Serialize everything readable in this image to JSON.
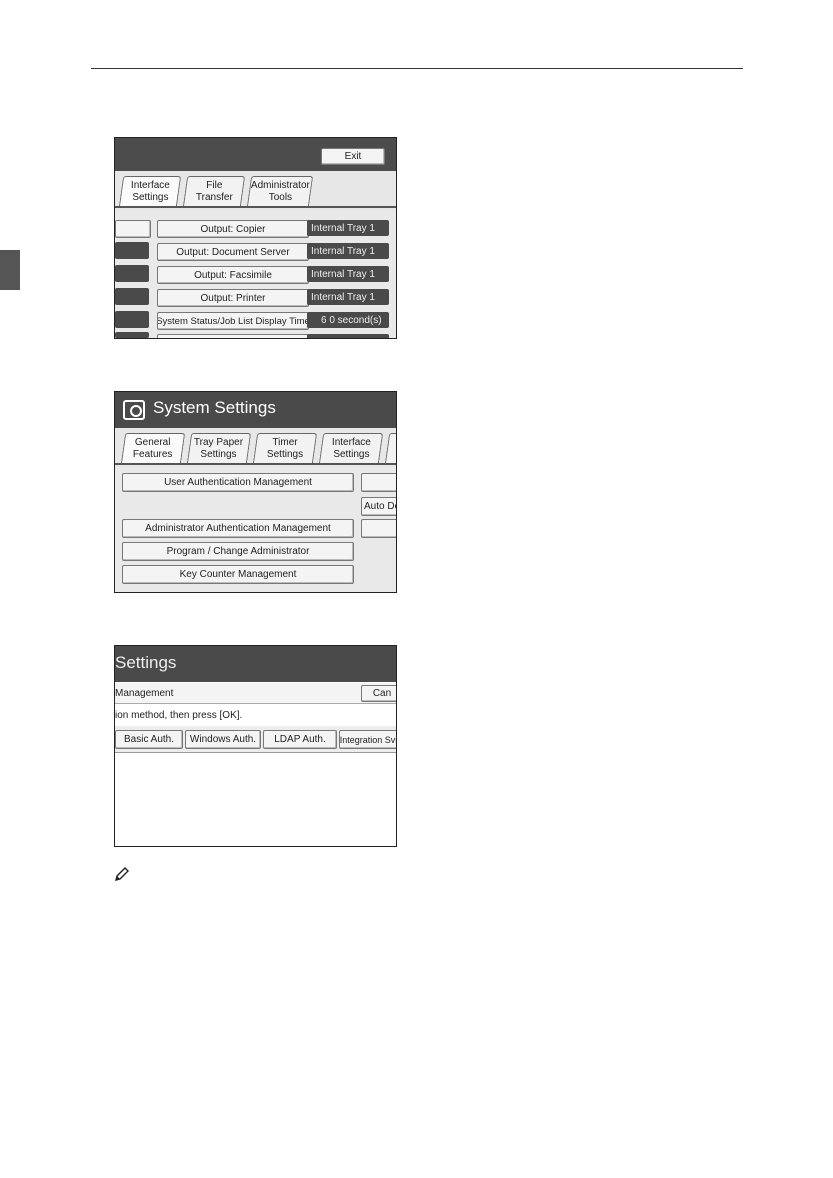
{
  "shot1": {
    "exit_label": "Exit",
    "tabs": [
      {
        "label": "Interface\nSettings"
      },
      {
        "label": "File\nTransfer"
      },
      {
        "label": "Administrator\nTools"
      }
    ],
    "rows": [
      {
        "label": "Output: Copier",
        "value": "Internal Tray 1"
      },
      {
        "label": "Output: Document Server",
        "value": "Internal Tray 1"
      },
      {
        "label": "Output: Facsimile",
        "value": "Internal Tray 1"
      },
      {
        "label": "Output: Printer",
        "value": "Internal Tray 1"
      },
      {
        "label": "System Status/Job List Display Time",
        "value": "6 0 second(s)"
      }
    ]
  },
  "shot2": {
    "title": "System Settings",
    "tabs": [
      {
        "label": "General\nFeatures"
      },
      {
        "label": "Tray Paper\nSettings"
      },
      {
        "label": "Timer\nSettings"
      },
      {
        "label": "Interface\nSettings"
      }
    ],
    "buttons": {
      "user_auth": "User Authentication Management",
      "auto_de": "Auto De",
      "admin_auth": "Administrator Authentication Management",
      "program_admin": "Program / Change Administrator",
      "key_counter": "Key Counter Management"
    }
  },
  "shot3": {
    "title": "Settings",
    "crumb": "Management",
    "cancel_label": "Can",
    "instruction": "ion method, then press [OK].",
    "options": [
      {
        "label": "Basic Auth."
      },
      {
        "label": "Windows Auth."
      },
      {
        "label": "LDAP Auth."
      },
      {
        "label": "Integration Svr."
      }
    ]
  }
}
